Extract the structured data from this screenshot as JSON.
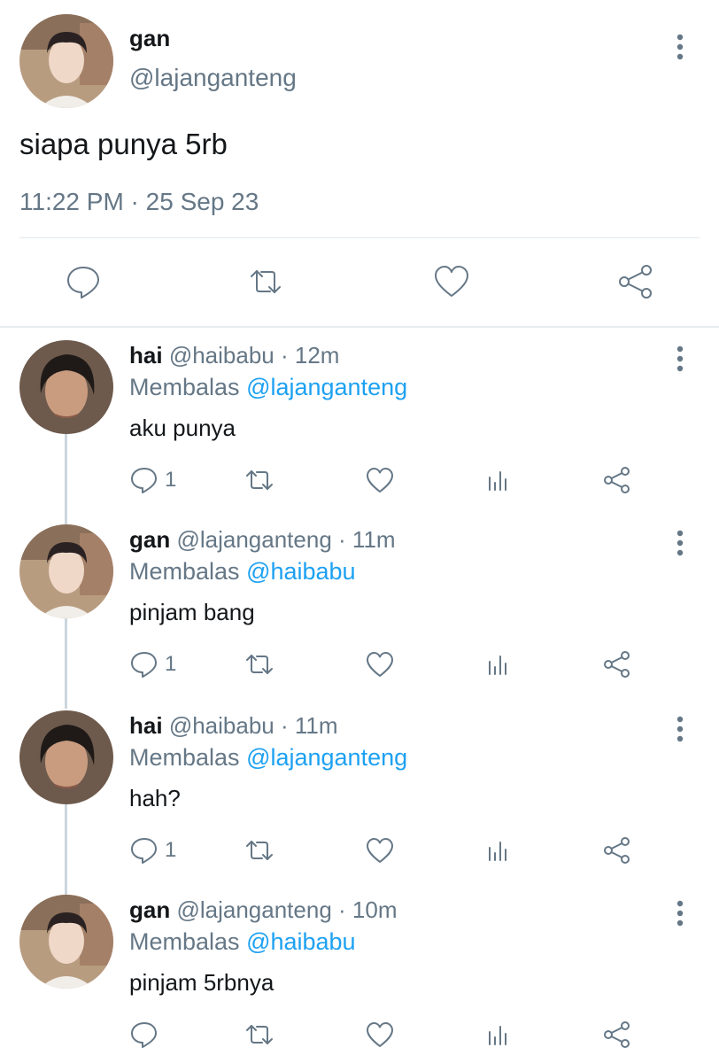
{
  "main_tweet": {
    "name": "gan",
    "handle": "@lajanganteng",
    "text": "siapa punya 5rb",
    "timestamp": "11:22 PM · 25 Sep 23",
    "actions": [
      "reply-icon",
      "retweet-icon",
      "like-icon",
      "share-icon"
    ]
  },
  "replies": [
    {
      "name": "hai",
      "handle": "@haibabu",
      "dot": "·",
      "time": "12m",
      "replying_label": "Membalas",
      "replying_to": "@lajanganteng",
      "text": "aku punya",
      "reply_count": "1"
    },
    {
      "name": "gan",
      "handle": "@lajanganteng",
      "dot": "·",
      "time": "11m",
      "replying_label": "Membalas",
      "replying_to": "@haibabu",
      "text": "pinjam bang",
      "reply_count": "1"
    },
    {
      "name": "hai",
      "handle": "@haibabu",
      "dot": "·",
      "time": "11m",
      "replying_label": "Membalas",
      "replying_to": "@lajanganteng",
      "text": "hah?",
      "reply_count": "1"
    },
    {
      "name": "gan",
      "handle": "@lajanganteng",
      "dot": "·",
      "time": "10m",
      "replying_label": "Membalas",
      "replying_to": "@haibabu",
      "text": "pinjam 5rbnya",
      "reply_count": ""
    }
  ],
  "colors": {
    "accent": "#1da1f2",
    "muted": "#657786",
    "text": "#14171a",
    "divider": "#e1e8ed"
  }
}
